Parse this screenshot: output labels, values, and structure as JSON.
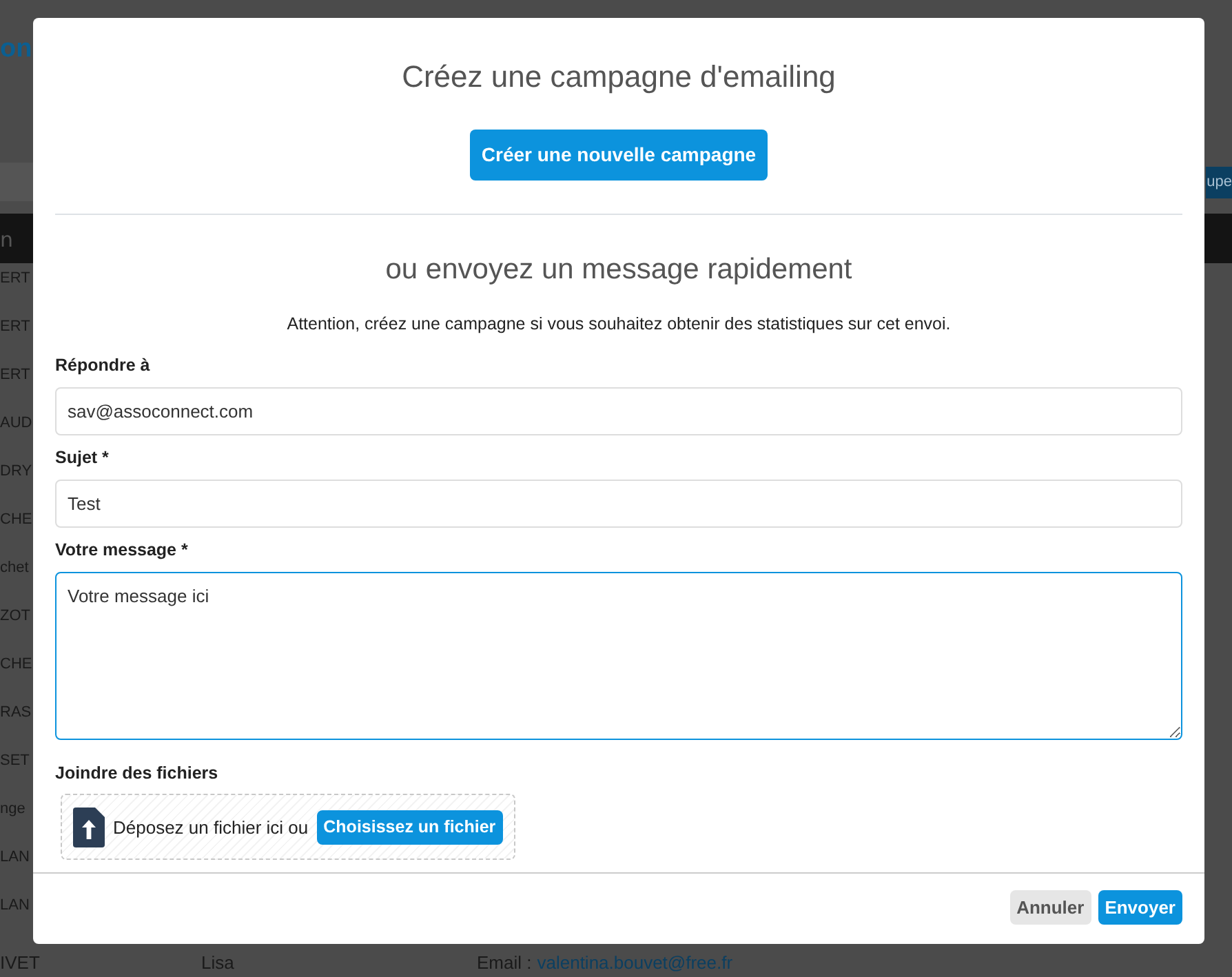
{
  "background": {
    "logo_fragment": "on",
    "header_fragment": "n",
    "right_button_fragment": "upe",
    "rows": [
      "ERT",
      "ERT",
      "ERT",
      "AUD",
      "DRY",
      "CHE",
      "chet",
      "ZOT",
      "CHE",
      "RAS",
      "SET",
      "nge",
      "LAN",
      "LAN"
    ],
    "bottom_row": {
      "name": "IVET",
      "first_name": "Lisa",
      "email_label": "Email :",
      "email": "valentina.bouvet@free.fr"
    }
  },
  "modal": {
    "title": "Créez une campagne d'emailing",
    "new_campaign_button": "Créer une nouvelle campagne",
    "subtitle": "ou envoyez un message rapidement",
    "notice": "Attention, créez une campagne si vous souhaitez obtenir des statistiques sur cet envoi.",
    "fields": [
      {
        "kind": "input",
        "label": "Répondre à",
        "value": "sav@assoconnect.com",
        "focused": false
      },
      {
        "kind": "input",
        "label": "Sujet *",
        "value": "Test",
        "focused": false
      },
      {
        "kind": "textarea",
        "label": "Votre message *",
        "value": "Votre message ici",
        "focused": true
      }
    ],
    "attachments": {
      "label": "Joindre des fichiers",
      "drop_text": "Déposez un fichier ici ou",
      "choose_button": "Choisissez un fichier"
    },
    "buttons": [
      {
        "kind": "secondary",
        "label": "Annuler"
      },
      {
        "kind": "primary",
        "label": "Envoyer"
      }
    ]
  }
}
